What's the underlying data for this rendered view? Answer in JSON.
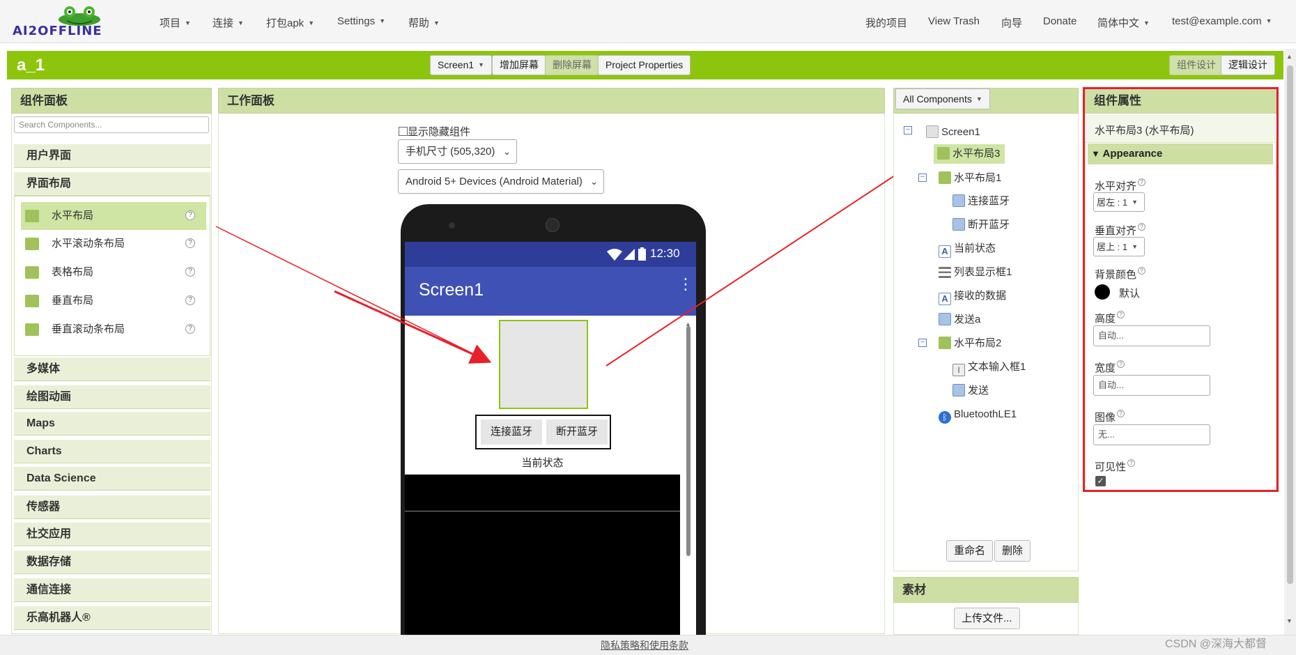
{
  "nav": {
    "logo_text": "AI2OFFLINE",
    "left_menu": [
      {
        "label": "项目",
        "has_caret": true
      },
      {
        "label": "连接",
        "has_caret": true
      },
      {
        "label": "打包apk",
        "has_caret": true
      },
      {
        "label": "Settings",
        "has_caret": true
      },
      {
        "label": "帮助",
        "has_caret": true
      }
    ],
    "right_menu": [
      {
        "label": "我的项目",
        "has_caret": false
      },
      {
        "label": "View Trash",
        "has_caret": false
      },
      {
        "label": "向导",
        "has_caret": false
      },
      {
        "label": "Donate",
        "has_caret": false
      },
      {
        "label": "简体中文",
        "has_caret": true
      },
      {
        "label": "test@example.com",
        "has_caret": true
      }
    ]
  },
  "project": {
    "name": "a_1",
    "screen_select": "Screen1",
    "add_screen": "增加屏幕",
    "remove_screen": "删除屏幕",
    "project_properties": "Project Properties",
    "designer_btn": "组件设计",
    "blocks_btn": "逻辑设计"
  },
  "palette": {
    "title": "组件面板",
    "search_placeholder": "Search Components...",
    "categories_top": [
      "用户界面",
      "界面布局"
    ],
    "layout_items": [
      {
        "label": "水平布局",
        "icon": "horizontal-layout-icon",
        "selected": true
      },
      {
        "label": "水平滚动条布局",
        "icon": "horizontal-scroll-layout-icon",
        "selected": false
      },
      {
        "label": "表格布局",
        "icon": "table-layout-icon",
        "selected": false
      },
      {
        "label": "垂直布局",
        "icon": "vertical-layout-icon",
        "selected": false
      },
      {
        "label": "垂直滚动条布局",
        "icon": "vertical-scroll-layout-icon",
        "selected": false
      }
    ],
    "categories_bottom": [
      "多媒体",
      "绘图动画",
      "Maps",
      "Charts",
      "Data Science",
      "传感器",
      "社交应用",
      "数据存储",
      "通信连接",
      "乐高机器人®"
    ]
  },
  "viewer": {
    "title": "工作面板",
    "show_hidden": "显示隐藏组件",
    "size_select": "手机尺寸 (505,320)",
    "theme_select": "Android 5+ Devices (Android Material)",
    "phone": {
      "time": "12:30",
      "screen_title": "Screen1",
      "btn_connect": "连接蓝牙",
      "btn_disconnect": "断开蓝牙",
      "status_label": "当前状态"
    }
  },
  "components": {
    "filter": "All Components",
    "tree": [
      {
        "label": "Screen1",
        "depth": 0,
        "toggle": true,
        "icon": "screen-icon"
      },
      {
        "label": "水平布局3",
        "depth": 1,
        "toggle": false,
        "icon": "horizontal-layout-icon",
        "selected": true
      },
      {
        "label": "水平布局1",
        "depth": 1,
        "toggle": true,
        "icon": "horizontal-layout-icon"
      },
      {
        "label": "连接蓝牙",
        "depth": 2,
        "toggle": false,
        "icon": "button-icon"
      },
      {
        "label": "断开蓝牙",
        "depth": 2,
        "toggle": false,
        "icon": "button-icon"
      },
      {
        "label": "当前状态",
        "depth": 1,
        "toggle": false,
        "icon": "label-icon"
      },
      {
        "label": "列表显示框1",
        "depth": 1,
        "toggle": false,
        "icon": "listview-icon"
      },
      {
        "label": "接收的数据",
        "depth": 1,
        "toggle": false,
        "icon": "label-icon"
      },
      {
        "label": "发送a",
        "depth": 1,
        "toggle": false,
        "icon": "button-icon"
      },
      {
        "label": "水平布局2",
        "depth": 1,
        "toggle": true,
        "icon": "horizontal-layout-icon"
      },
      {
        "label": "文本输入框1",
        "depth": 2,
        "toggle": false,
        "icon": "textbox-icon"
      },
      {
        "label": "发送",
        "depth": 2,
        "toggle": false,
        "icon": "button-icon"
      },
      {
        "label": "BluetoothLE1",
        "depth": 1,
        "toggle": false,
        "icon": "bluetooth-icon"
      }
    ],
    "rename": "重命名",
    "delete": "删除"
  },
  "media": {
    "title": "素材",
    "upload": "上传文件..."
  },
  "properties": {
    "title": "组件属性",
    "component": "水平布局3 (水平布局)",
    "section": "Appearance",
    "align_h_label": "水平对齐",
    "align_h_value": "居左 : 1",
    "align_v_label": "垂直对齐",
    "align_v_value": "居上 : 1",
    "bg_label": "背景颜色",
    "bg_value": "默认",
    "height_label": "高度",
    "height_value": "自动...",
    "width_label": "宽度",
    "width_value": "自动...",
    "image_label": "图像",
    "image_value": "无...",
    "visible_label": "可见性",
    "visible_checked": true
  },
  "footer": {
    "privacy": "隐私策略和使用条款",
    "watermark": "CSDN @深海大都督"
  },
  "colors": {
    "project_bar": "#8dc50d",
    "panel_header": "#cddfa3",
    "annotation_red": "#e8202a",
    "appbar": "#3f51b5"
  }
}
